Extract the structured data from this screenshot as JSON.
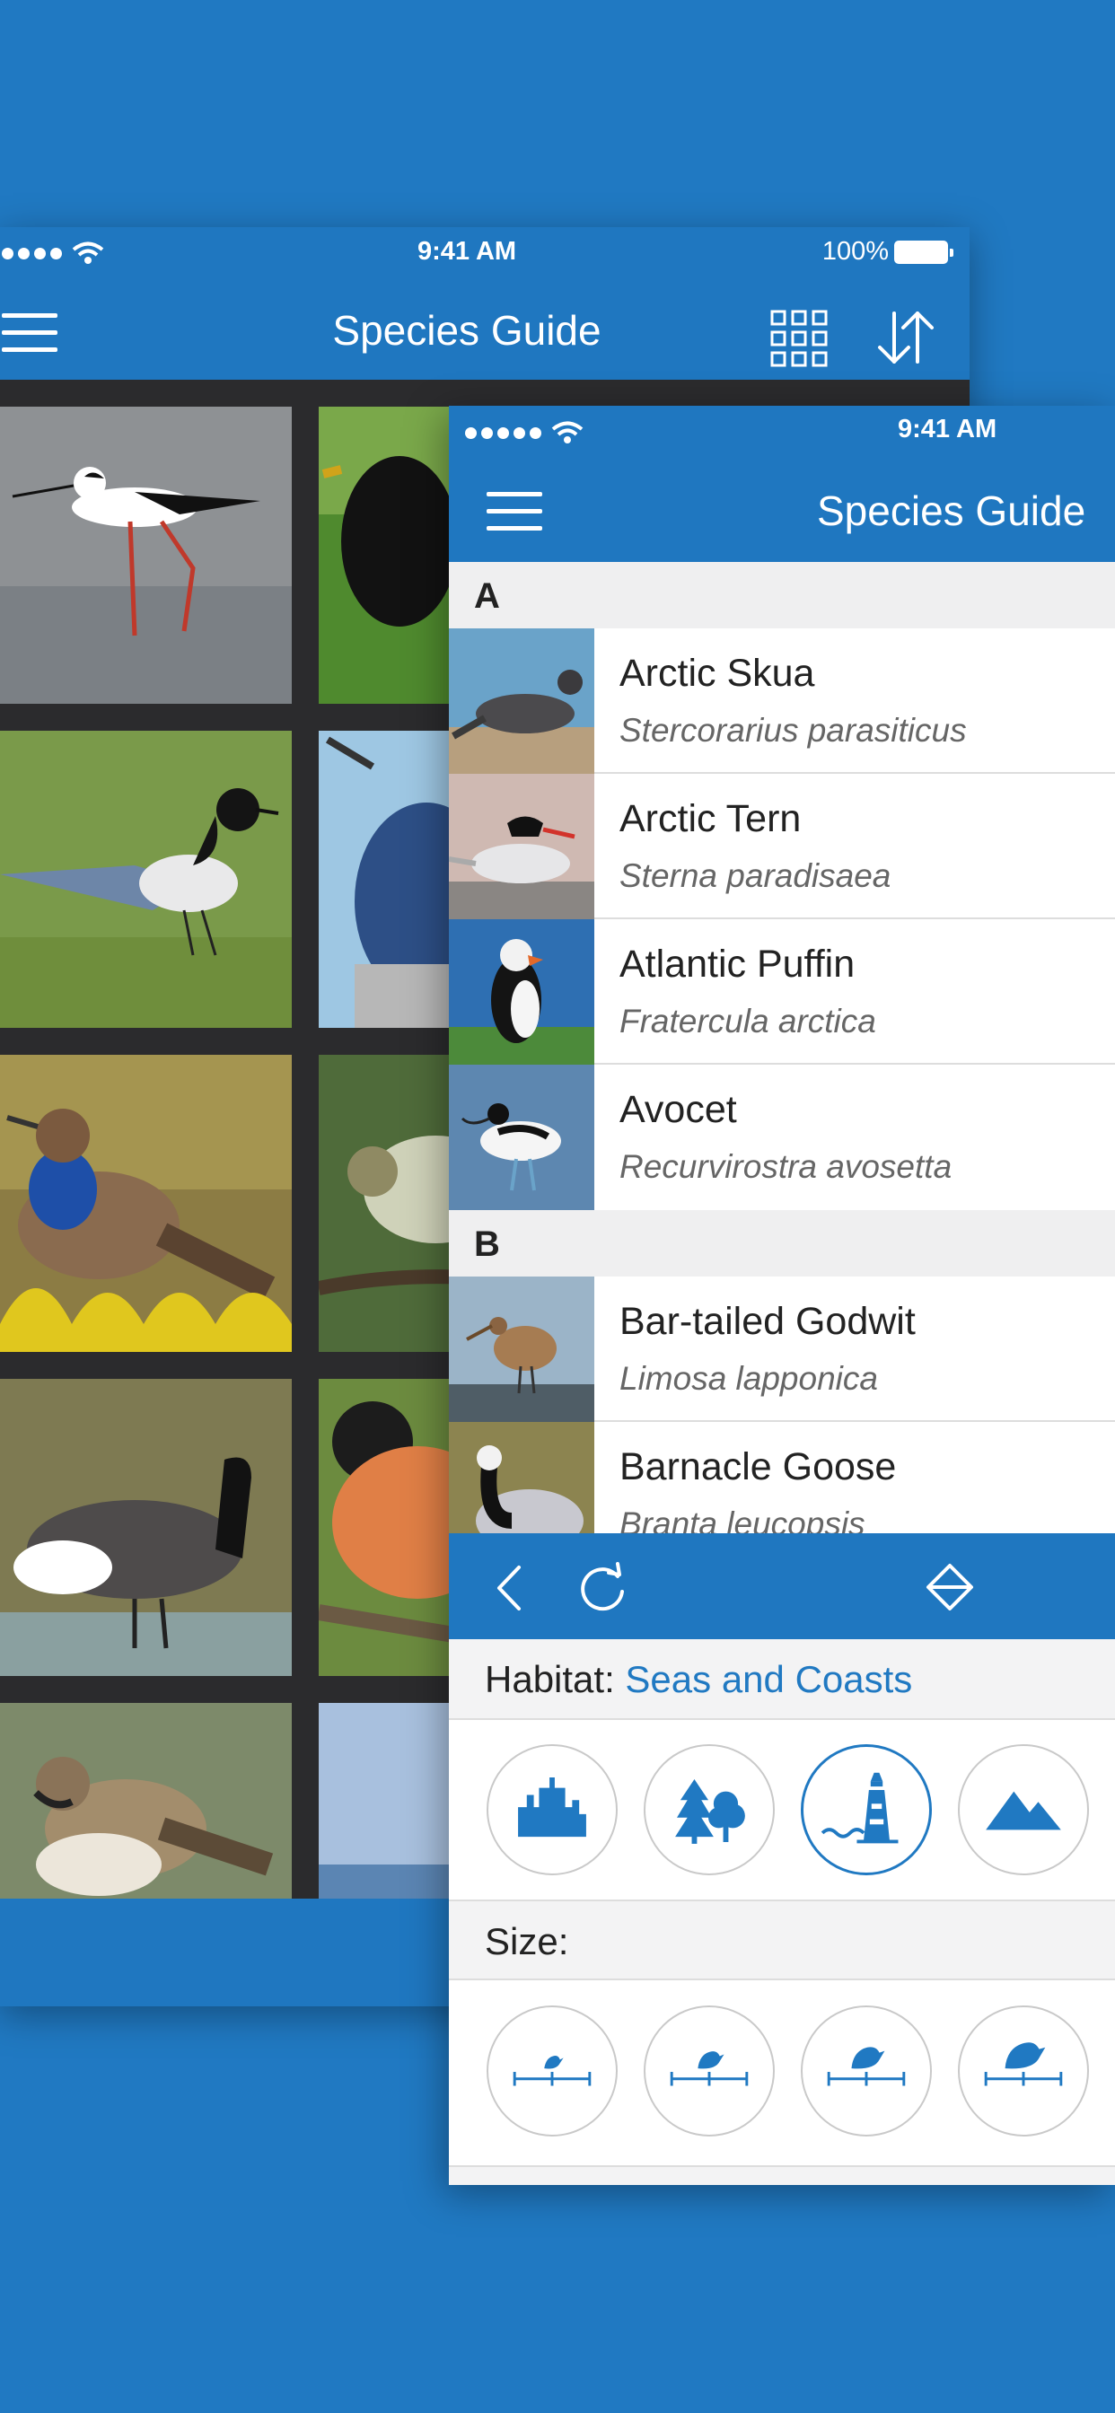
{
  "colors": {
    "brand": "#1f77c0",
    "accent": "#2079c2",
    "background": "#2079c2"
  },
  "back_phone": {
    "status": {
      "time": "9:41 AM",
      "battery": "100%"
    },
    "nav": {
      "title": "Species Guide",
      "menu_icon": "menu-icon",
      "grid_icon": "grid-view-icon",
      "sort_icon": "sort-icon"
    }
  },
  "front_phone": {
    "status": {
      "time": "9:41 AM"
    },
    "nav": {
      "title": "Species Guide",
      "menu_icon": "menu-icon"
    },
    "sections": [
      {
        "letter": "A",
        "rows": [
          {
            "name": "Arctic Skua",
            "latin": "Stercorarius parasiticus"
          },
          {
            "name": "Arctic Tern",
            "latin": "Sterna paradisaea"
          },
          {
            "name": "Atlantic Puffin",
            "latin": "Fratercula arctica"
          },
          {
            "name": "Avocet",
            "latin": "Recurvirostra avosetta"
          }
        ]
      },
      {
        "letter": "B",
        "rows": [
          {
            "name": "Bar-tailed Godwit",
            "latin": "Limosa lapponica"
          },
          {
            "name": "Barnacle Goose",
            "latin": "Branta leucopsis"
          }
        ]
      }
    ],
    "toolbar": {
      "back_icon": "chevron-left-icon",
      "refresh_icon": "refresh-icon",
      "collapse_icon": "collapse-icon"
    },
    "filters": {
      "habitat_label": "Habitat:",
      "habitat_value": "Seas and Coasts",
      "habitat_options": [
        "city-icon",
        "woodland-icon",
        "coast-lighthouse-icon",
        "mountain-icon"
      ],
      "habitat_selected": 2,
      "size_label": "Size:",
      "size_options": [
        "bird-size-1-icon",
        "bird-size-2-icon",
        "bird-size-3-icon",
        "bird-size-4-icon"
      ]
    }
  }
}
